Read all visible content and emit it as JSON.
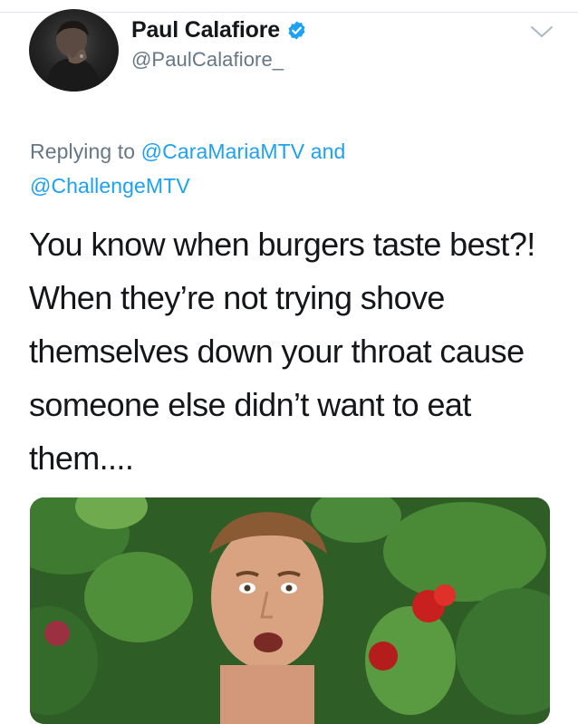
{
  "tweet": {
    "author": {
      "display_name": "Paul Calafiore",
      "handle": "@PaulCalafiore_",
      "verified": true,
      "avatar_icon": "profile-photo"
    },
    "reply_prefix": "Replying to",
    "reply_to_1": "@CaraMariaMTV",
    "reply_conjunction": "and",
    "reply_to_2": "@ChallengeMTV",
    "text": "You know when burgers taste best?! When they’re not trying shove themselves down your throat cause someone else didn’t want to eat them....",
    "media_icon": "image-attachment",
    "menu_icon": "chevron-down-icon"
  },
  "colors": {
    "link": "#1da1f2",
    "secondary_text": "#657786",
    "primary_text": "#14171a",
    "verified_badge": "#1da1f2"
  }
}
